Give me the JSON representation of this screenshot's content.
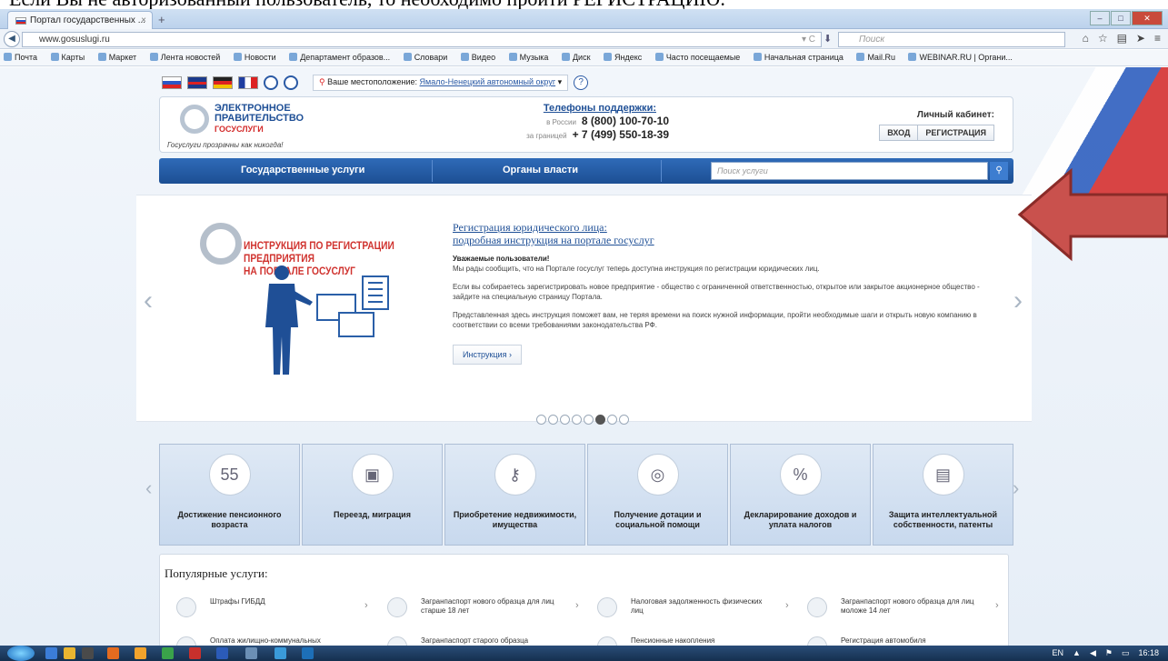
{
  "caption": "Если Вы не авторизованный пользователь, то необходимо пройти РЕГИСТРАЦИЮ:",
  "browser": {
    "tab_title": "Портал государственных ...",
    "tab_close": "×",
    "new_tab": "+",
    "url": "www.gosuslugi.ru",
    "search_placeholder": "Поиск",
    "bookmarks": [
      "Почта",
      "Карты",
      "Маркет",
      "Лента новостей",
      "Новости",
      "Департамент образов...",
      "Словари",
      "Видео",
      "Музыка",
      "Диск",
      "Яндекс",
      "Часто посещаемые",
      "Начальная страница",
      "Mail.Ru",
      "WEBINAR.RU | Органи..."
    ]
  },
  "topbar": {
    "location_label": "Ваше местоположение:",
    "location_value": "Ямало-Ненецкий автономный округ",
    "help": "?"
  },
  "header": {
    "logo_line1": "ЭЛЕКТРОННОЕ",
    "logo_line2": "ПРАВИТЕЛЬСТВО",
    "logo_line3": "ГОСУСЛУГИ",
    "slogan": "Госуслуги прозрачны как никогда!",
    "support_title": "Телефоны поддержки:",
    "russia_label": "в России",
    "russia_phone": "8 (800) 100-70-10",
    "abroad_label": "за границей",
    "abroad_phone": "+ 7 (499) 550-18-39",
    "cabinet_title": "Личный кабинет:",
    "login": "ВХОД",
    "register": "РЕГИСТРАЦИЯ"
  },
  "mainnav": {
    "services": "Государственные услуги",
    "authorities": "Органы власти",
    "search_placeholder": "Поиск услуги"
  },
  "slider": {
    "headline_line1": "ИНСТРУКЦИЯ ПО РЕГИСТРАЦИИ ПРЕДПРИЯТИЯ",
    "headline_line2": "НА ПОРТАЛЕ ГОСУСЛУГ",
    "title_line1": "Регистрация юридического лица:",
    "title_line2": "подробная инструкция на портале госуслуг",
    "greeting": "Уважаемые пользователи!",
    "p1": "Мы рады сообщить, что на Портале госуслуг теперь доступна инструкция по регистрации юридических лиц.",
    "p2": "Если вы собираетесь зарегистрировать новое предприятие - общество с ограниченной ответственностью, открытое или закрытое акционерное общество - зайдите на специальную страницу Портала.",
    "p3": "Представленная здесь инструкция поможет вам, не теряя времени на поиск нужной информации, пройти необходимые шаги и открыть новую компанию в соответствии со всеми требованиями законодательства РФ.",
    "button": "Инструкция ›",
    "prev": "‹",
    "next": "›",
    "active_dot": 5
  },
  "tiles": [
    {
      "icon": "55",
      "label": "Достижение пенсионного возраста"
    },
    {
      "icon": "▣",
      "label": "Переезд, миграция"
    },
    {
      "icon": "⚷",
      "label": "Приобретение недвижимости, имущества"
    },
    {
      "icon": "◎",
      "label": "Получение дотации и социальной помощи"
    },
    {
      "icon": "%",
      "label": "Декларирование доходов и уплата налогов"
    },
    {
      "icon": "▤",
      "label": "Защита интеллектуальной собственности, патенты"
    }
  ],
  "popular": {
    "title": "Популярные услуги:",
    "items": [
      "Штрафы ГИБДД",
      "Загранпаспорт нового образца для лиц старше 18 лет",
      "Налоговая задолженность физических лиц",
      "Загранпаспорт нового образца для лиц моложе 14 лет",
      "Оплата жилищно-коммунальных",
      "Загранпаспорт старого образца",
      "Пенсионные накопления",
      "Регистрация автомобиля"
    ],
    "chevron": "›"
  },
  "taskbar": {
    "lang": "EN",
    "time": "16:18"
  }
}
